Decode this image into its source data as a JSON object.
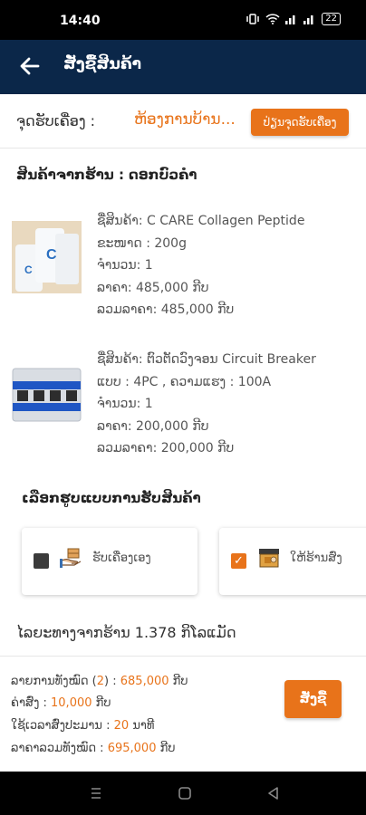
{
  "status_bar": {
    "time": "14:40",
    "battery": "22"
  },
  "app_bar": {
    "title": "ສັ່ງຊື້ສິນຄ້າ"
  },
  "pickup": {
    "label": "ຈຸດຮັບເຄື່ອງ :",
    "value": "ຫ້ອງການບ້ານ...",
    "edit_button": "ປ່ຽນຈຸດຮັບເຄື່ອງ"
  },
  "shop": {
    "title": "ສິນຄ້າຈາກຮ້ານ : ດອກບົວຄໍາ"
  },
  "products": [
    {
      "name": "ຊື່ສິນຄ້າ: C CARE Collagen Peptide",
      "spec": "ຂະໜາດ : 200g",
      "qty": "ຈໍານວນ: 1",
      "price": "ລາຄາ: 485,000 ກີບ",
      "total": "ລວມລາຄາ: 485,000 ກີບ"
    },
    {
      "name": "ຊື່ສິນຄ້າ: ຕົວຕັດວົງຈອນ Circuit Breaker",
      "spec": "ແບບ : 4PC , ຄວາມແຮງ : 100A",
      "qty": "ຈໍານວນ: 1",
      "price": "ລາຄາ: 200,000 ກີບ",
      "total": "ລວມລາຄາ: 200,000 ກີບ"
    }
  ],
  "delivery": {
    "title": "ເລືອກຮູບແບບການຮັບສິນຄ້າ",
    "options": [
      {
        "label": "ຮັບເຄື່ອງເອງ",
        "checked": false,
        "icon": "hand-box-icon"
      },
      {
        "label": "ໃຫ້ຮ້ານສົ່ງ",
        "checked": true,
        "icon": "delivery-icon"
      }
    ]
  },
  "distance": "ໄລຍະທາງຈາກຮ້ານ 1.378 ກິໂລແມັດ",
  "summary": {
    "items_label": "ລາຍການທັງໝົດ (",
    "items_count": "2",
    "items_close": ") : ",
    "items_amount": "685,000",
    "currency": " ກີບ",
    "shipping_label": "ຄ່າສົ່ງ : ",
    "shipping_amount": "10,000",
    "time_label": "ໃຊ້ເວລາສົ່ງປະມານ : ",
    "time_amount": "20",
    "time_unit": " ນາທີ",
    "grand_label": "ລາຄາລວມທັງໝົດ : ",
    "grand_amount": "695,000"
  },
  "order_button": "ສັ່ງຊື້",
  "colors": {
    "accent": "#e8731a",
    "header": "#0b2749"
  }
}
